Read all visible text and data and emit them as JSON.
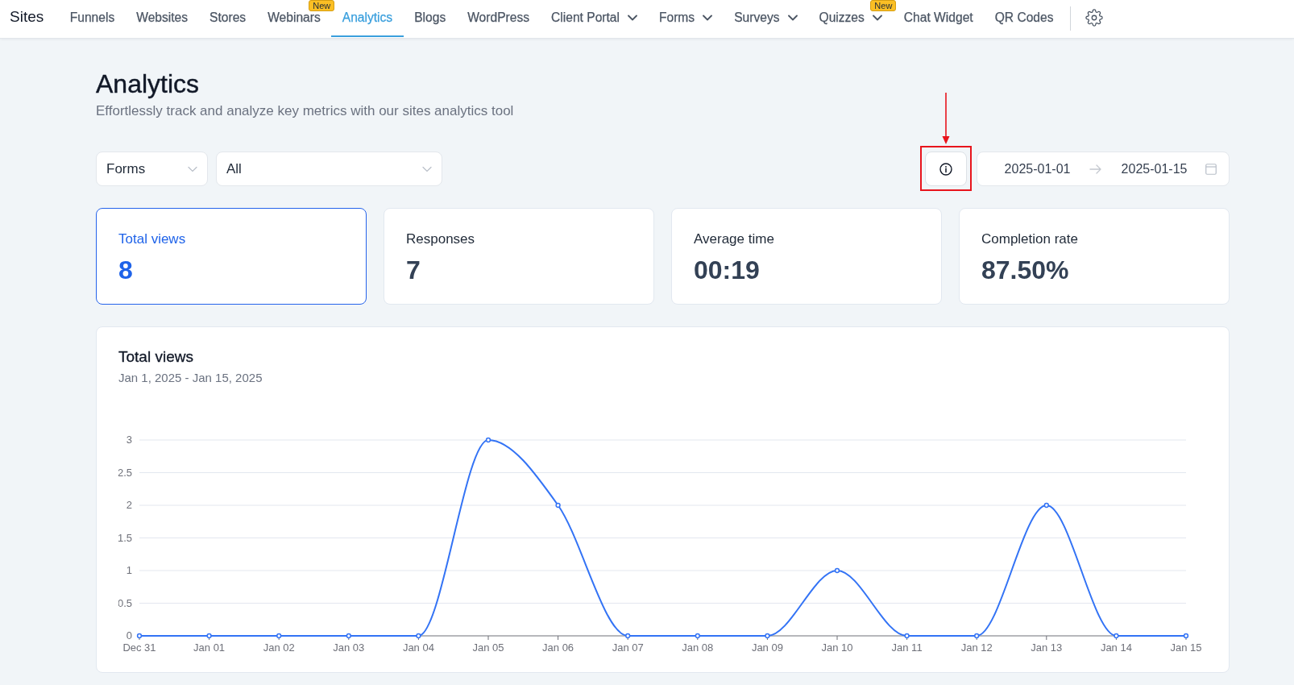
{
  "nav": {
    "brand": "Sites",
    "items": [
      {
        "label": "Funnels",
        "selected": false,
        "menu": false
      },
      {
        "label": "Websites",
        "selected": false,
        "menu": false
      },
      {
        "label": "Stores",
        "selected": false,
        "menu": false
      },
      {
        "label": "Webinars",
        "selected": false,
        "menu": false,
        "badge": "New"
      },
      {
        "label": "Analytics",
        "selected": true,
        "menu": false
      },
      {
        "label": "Blogs",
        "selected": false,
        "menu": false
      },
      {
        "label": "WordPress",
        "selected": false,
        "menu": false
      },
      {
        "label": "Client Portal",
        "selected": false,
        "menu": true
      },
      {
        "label": "Forms",
        "selected": false,
        "menu": true
      },
      {
        "label": "Surveys",
        "selected": false,
        "menu": true
      },
      {
        "label": "Quizzes",
        "selected": false,
        "menu": true,
        "badge": "New"
      },
      {
        "label": "Chat Widget",
        "selected": false,
        "menu": false
      },
      {
        "label": "QR Codes",
        "selected": false,
        "menu": false
      }
    ]
  },
  "header": {
    "title": "Analytics",
    "subtitle": "Effortlessly track and analyze key metrics with our sites analytics tool"
  },
  "filters": {
    "selects": [
      {
        "value": "Forms"
      },
      {
        "value": "All"
      }
    ],
    "info_button": {
      "highlighted": true
    },
    "date_range": {
      "start": "2025-01-01",
      "end": "2025-01-15"
    }
  },
  "metrics": [
    {
      "label": "Total views",
      "value": "8",
      "selected": true
    },
    {
      "label": "Responses",
      "value": "7",
      "selected": false
    },
    {
      "label": "Average time",
      "value": "00:19",
      "selected": false
    },
    {
      "label": "Completion rate",
      "value": "87.50%",
      "selected": false
    }
  ],
  "chart": {
    "subtitle": "Jan 1, 2025 - Jan 15, 2025",
    "chart_data": {
      "type": "line",
      "title": "Total views",
      "categories": [
        "Dec 31",
        "Jan 01",
        "Jan 02",
        "Jan 03",
        "Jan 04",
        "Jan 05",
        "Jan 06",
        "Jan 07",
        "Jan 08",
        "Jan 09",
        "Jan 10",
        "Jan 11",
        "Jan 12",
        "Jan 13",
        "Jan 14",
        "Jan 15"
      ],
      "values": [
        0,
        0,
        0,
        0,
        0,
        3,
        2,
        0,
        0,
        0,
        1,
        0,
        0,
        2,
        0,
        0
      ],
      "ylim": [
        0,
        3
      ],
      "yticks": [
        0,
        0.5,
        1,
        1.5,
        2,
        2.5,
        3
      ],
      "grid": true,
      "marker": true
    }
  }
}
